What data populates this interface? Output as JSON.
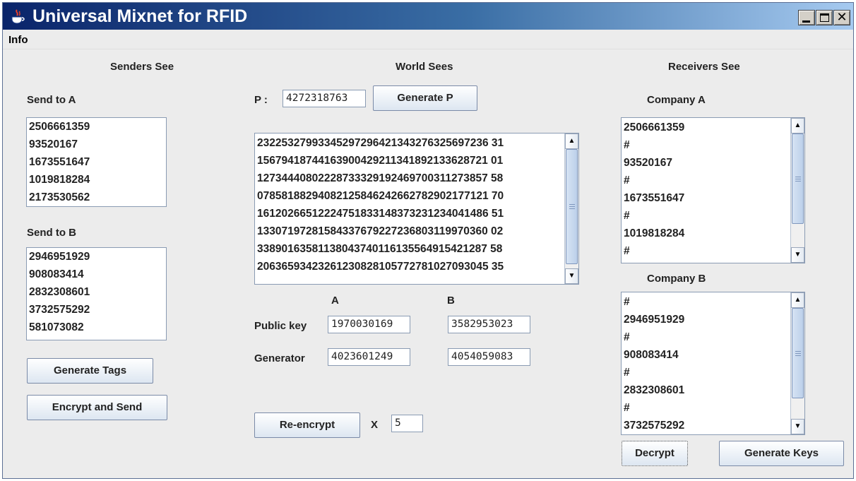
{
  "window": {
    "title": "Universal Mixnet for RFID"
  },
  "menu": {
    "items": [
      "Info"
    ]
  },
  "senders": {
    "header": "Senders See",
    "send_to_a_label": "Send to A",
    "list_a": [
      "2506661359",
      "93520167",
      "1673551647",
      "1019818284",
      "2173530562"
    ],
    "send_to_b_label": "Send to B",
    "list_b": [
      "2946951929",
      "908083414",
      "2832308601",
      "3732575292",
      "581073082"
    ],
    "generate_tags_label": "Generate Tags",
    "encrypt_send_label": "Encrypt and Send"
  },
  "world": {
    "header": "World Sees",
    "p_label": "P :",
    "p_value": "4272318763",
    "generate_p_label": "Generate P",
    "ciphertext_lines": [
      "23225327993345297296421343276325697236 31",
      "15679418744163900429211341892133628721 01",
      "12734440802228733329192469700311273857 58",
      "07858188294082125846242662782902177121 70",
      "16120266512224751833148373231234041486 51",
      "13307197281584337679227236803119970360 02",
      "33890163581138043740116135564915421287 58",
      "20636593423261230828105772781027093045 35"
    ],
    "col_a_label": "A",
    "col_b_label": "B",
    "public_key_label": "Public key",
    "public_key_a": "1970030169",
    "public_key_b": "3582953023",
    "generator_label": "Generator",
    "generator_a": "4023601249",
    "generator_b": "4054059083",
    "reencrypt_label": "Re-encrypt",
    "x_label": "X",
    "x_value": "5"
  },
  "receivers": {
    "header": "Receivers See",
    "company_a_label": "Company A",
    "list_a": [
      "2506661359",
      "#",
      "93520167",
      "#",
      "1673551647",
      "#",
      "1019818284",
      "#"
    ],
    "company_b_label": "Company B",
    "list_b": [
      "#",
      "2946951929",
      "#",
      "908083414",
      "#",
      "2832308601",
      "#",
      "3732575292"
    ],
    "decrypt_label": "Decrypt",
    "generate_keys_label": "Generate Keys"
  }
}
